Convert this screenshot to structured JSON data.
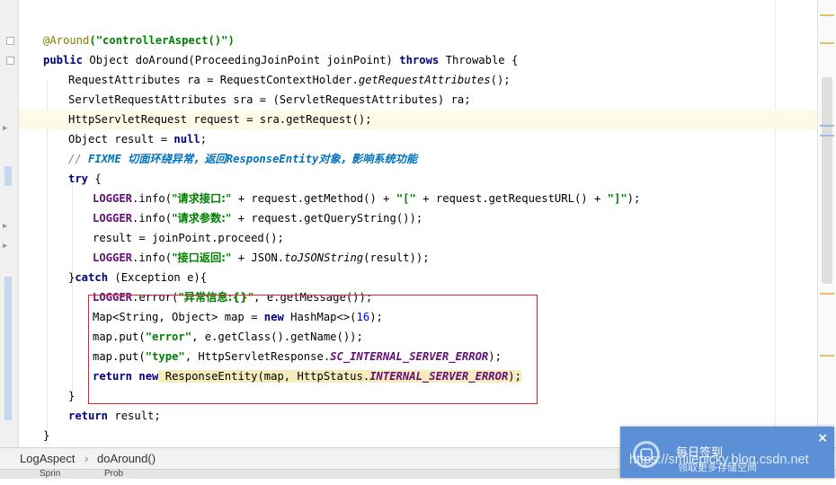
{
  "code": {
    "annotation": "@Around",
    "annotation_arg": "(\"controllerAspect()\")",
    "kw_public": "public",
    "method_decl": " Object doAround(ProceedingJoinPoint joinPoint) ",
    "kw_throws": "throws",
    "throws_type": " Throwable {",
    "l3_a": "RequestAttributes ra = RequestContextHolder.",
    "l3_b": "getRequestAttributes",
    "l3_c": "();",
    "l4": "ServletRequestAttributes sra = (ServletRequestAttributes) ra;",
    "l5": "HttpServletRequest request = sra.getRequest();",
    "l6_a": "Object result = ",
    "l6_null": "null",
    "l6_c": ";",
    "l7_slash": "// ",
    "l7_fixme": "FIXME ",
    "l7_t1": "切面环绕异常，返回",
    "l7_resp": "ResponseEntity",
    "l7_t2": "对象，影响系统功能",
    "kw_try": "try",
    "brace_open": " {",
    "logger": "LOGGER",
    "info": ".info(",
    "error_call": ".error(",
    "l9_str": "\"请求接口:\"",
    "l9_rest": " + request.getMethod() + ",
    "l9_str2": "\"[\"",
    "l9_rest2": " + request.getRequestURL() + ",
    "l9_str3": "\"]\"",
    "close_paren": ");",
    "l10_str": "\"请求参数:\"",
    "l10_rest": " + request.getQueryString());",
    "l11": "result = joinPoint.proceed();",
    "l12_str": "\"接口返回:\"",
    "l12_rest": " + JSON.",
    "l12_it": "toJSONString",
    "l12_end": "(result));",
    "catch_brace": "}",
    "kw_catch": "catch",
    "catch_rest": " (Exception e){",
    "l14_str": "\"异常信息:{}\"",
    "l14_rest": ", e.getMessage());",
    "l15_a": "Map<String, Object> map = ",
    "kw_new": "new",
    "l15_b": " HashMap<>(",
    "l15_num": "16",
    "l15_c": ");",
    "l16_a": "map.put(",
    "l16_str": "\"error\"",
    "l16_b": ", e.getClass().getName());",
    "l17_a": "map.put(",
    "l17_str": "\"type\"",
    "l17_b": ", HttpServletResponse.",
    "l17_field": "SC_INTERNAL_SERVER_ERROR",
    "l17_c": ");",
    "kw_return": "return",
    "l18_b": " ResponseEntity(map, HttpStatus.",
    "l18_field": "INTERNAL_SERVER_ERROR",
    "l18_c": ");",
    "close_brace": "}",
    "l20_rest": " result;"
  },
  "breadcrumb": {
    "class_name": "LogAspect",
    "separator": "›",
    "method_name": "doAround()"
  },
  "bottom_tabs": [
    "Sprin",
    "Prob"
  ],
  "toast": {
    "title": "每日签到",
    "subtitle": "领取更多存储空间",
    "close": "×"
  },
  "watermark": "https://smileplcky.blog.csdn.net",
  "colors": {
    "keyword": "#000080",
    "string": "#008000",
    "annotation": "#808000",
    "static_field": "#660e7a",
    "number": "#0000ff",
    "todo_comment": "#0073bf",
    "highlight_box": "#d9262d",
    "toast_bg": "#5b8fd6"
  }
}
